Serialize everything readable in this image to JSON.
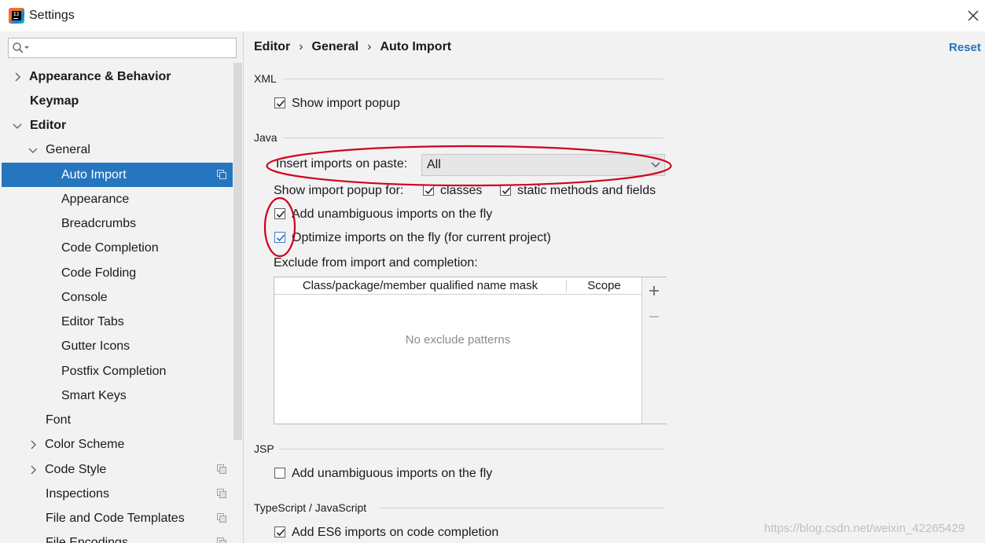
{
  "window": {
    "title": "Settings"
  },
  "search": {
    "placeholder": ""
  },
  "sidebar": {
    "items": [
      {
        "label": "Appearance & Behavior"
      },
      {
        "label": "Keymap"
      },
      {
        "label": "Editor"
      },
      {
        "label": "General"
      },
      {
        "label": "Auto Import"
      },
      {
        "label": "Appearance"
      },
      {
        "label": "Breadcrumbs"
      },
      {
        "label": "Code Completion"
      },
      {
        "label": "Code Folding"
      },
      {
        "label": "Console"
      },
      {
        "label": "Editor Tabs"
      },
      {
        "label": "Gutter Icons"
      },
      {
        "label": "Postfix Completion"
      },
      {
        "label": "Smart Keys"
      },
      {
        "label": "Font"
      },
      {
        "label": "Color Scheme"
      },
      {
        "label": "Code Style"
      },
      {
        "label": "Inspections"
      },
      {
        "label": "File and Code Templates"
      },
      {
        "label": "File Encodings"
      }
    ]
  },
  "breadcrumb": {
    "items": [
      "Editor",
      "General",
      "Auto Import"
    ],
    "separator": "›"
  },
  "header": {
    "reset_label": "Reset"
  },
  "xml": {
    "title": "XML",
    "show_import_popup": {
      "label": "Show import popup",
      "checked": true
    }
  },
  "java": {
    "title": "Java",
    "insert_imports_label": "Insert imports on paste:",
    "insert_imports_value": "All",
    "show_popup_for_label": "Show import popup for:",
    "classes": {
      "label": "classes",
      "checked": true
    },
    "static_methods": {
      "label": "static methods and fields",
      "checked": true
    },
    "add_unambiguous": {
      "label": "Add unambiguous imports on the fly",
      "checked": true
    },
    "optimize_imports": {
      "label": "Optimize imports on the fly (for current project)",
      "checked": true
    },
    "exclude_label": "Exclude from import and completion:",
    "exclude_table": {
      "columns": [
        "Class/package/member qualified name mask",
        "Scope"
      ],
      "rows": [],
      "empty_text": "No exclude patterns"
    }
  },
  "jsp": {
    "title": "JSP",
    "add_unambiguous": {
      "label": "Add unambiguous imports on the fly",
      "checked": false
    }
  },
  "typescript": {
    "title": "TypeScript / JavaScript",
    "add_es6": {
      "label": "Add ES6 imports on code completion",
      "checked": true
    }
  },
  "watermark": "https://blog.csdn.net/weixin_42265429",
  "colors": {
    "accent": "#2675bf",
    "annotation": "#d0021b",
    "panel_bg": "#f2f2f2"
  }
}
